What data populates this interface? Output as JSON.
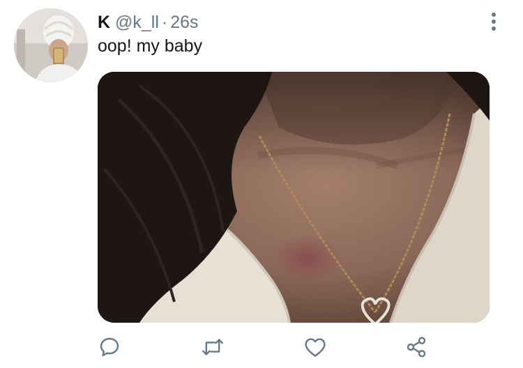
{
  "tweet": {
    "display_name": "K",
    "handle": "@k_ll",
    "separator": "·",
    "time": "26s",
    "text": "oop! my baby"
  },
  "icons": {
    "more": "more-vertical-icon",
    "reply": "reply-bubble-icon",
    "retweet": "retweet-icon",
    "like": "heart-icon",
    "share": "share-icon"
  },
  "colors": {
    "name": "#14171a",
    "meta": "#657786",
    "icon": "#657786"
  }
}
